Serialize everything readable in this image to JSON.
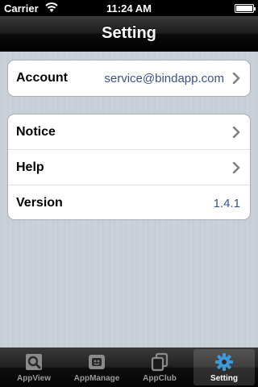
{
  "status_bar": {
    "carrier": "Carrier",
    "time": "11:24 AM"
  },
  "nav": {
    "title": "Setting"
  },
  "groups": [
    {
      "rows": [
        {
          "label": "Account",
          "value": "service@bindapp.com",
          "has_chevron": true
        }
      ]
    },
    {
      "rows": [
        {
          "label": "Notice",
          "value": "",
          "has_chevron": true
        },
        {
          "label": "Help",
          "value": "",
          "has_chevron": true
        },
        {
          "label": "Version",
          "value": "1.4.1",
          "has_chevron": false
        }
      ]
    }
  ],
  "tabs": [
    {
      "label": "AppView",
      "icon": "magnifier-icon",
      "selected": false
    },
    {
      "label": "AppManage",
      "icon": "app-manage-icon",
      "selected": false
    },
    {
      "label": "AppClub",
      "icon": "app-club-icon",
      "selected": false
    },
    {
      "label": "Setting",
      "icon": "gear-icon",
      "selected": true
    }
  ],
  "colors": {
    "value_text": "#385487",
    "selected_tab_icon": "#3d9ad8",
    "background": "#c5ccd4"
  }
}
